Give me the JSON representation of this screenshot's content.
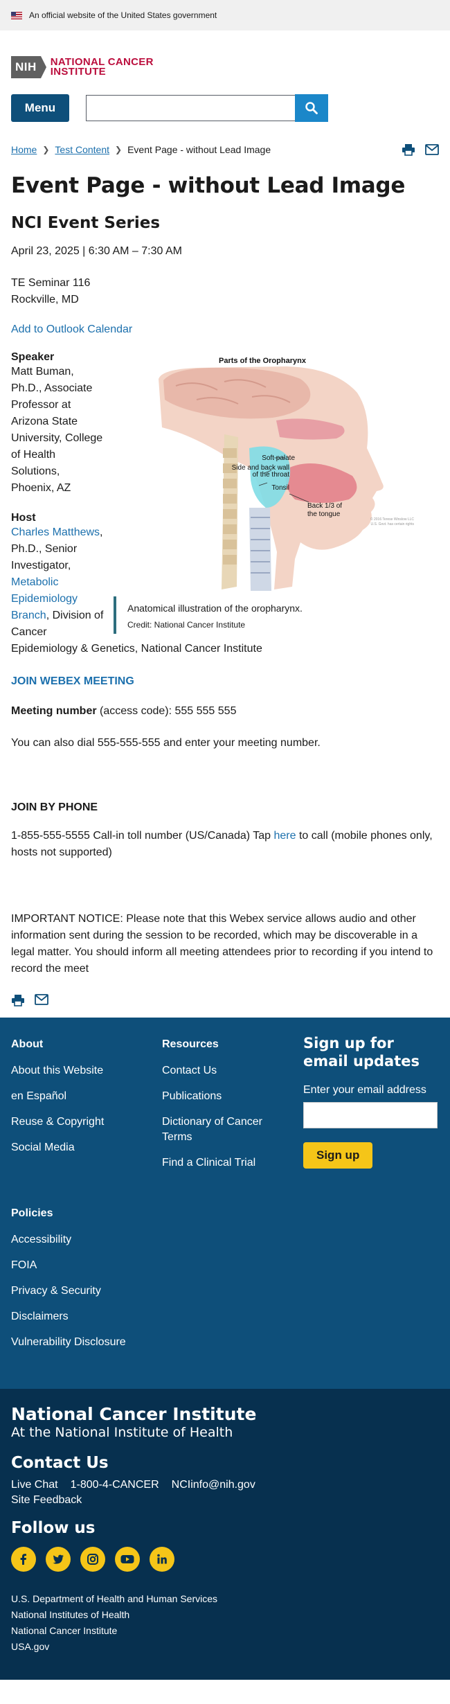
{
  "gov_banner": {
    "text": "An official website of the United States government"
  },
  "logo": {
    "nih": "NIH",
    "line1": "NATIONAL CANCER",
    "line2": "INSTITUTE"
  },
  "header": {
    "menu_label": "Menu",
    "search_placeholder": ""
  },
  "breadcrumb": {
    "items": [
      "Home",
      "Test Content"
    ],
    "current": "Event Page - without Lead Image"
  },
  "page": {
    "title": "Event Page - without Lead Image",
    "series": "NCI Event Series",
    "date": "April 23, 2025 | 6:30 AM – 7:30 AM",
    "venue_line1": "TE Seminar 116",
    "venue_line2": "Rockville, MD",
    "calendar_link": "Add to Outlook Calendar"
  },
  "speaker": {
    "label": "Speaker",
    "text": "Matt Buman, Ph.D., Associate Professor at Arizona State University, College of Health Solutions, Phoenix, AZ"
  },
  "host": {
    "label": "Host",
    "name_link": "Charles Matthews",
    "title": ", Ph.D., Senior Investigator, ",
    "branch_link": "Metabolic Epidemiology Branch",
    "division": ", Division of Cancer Epidemiology & Genetics, National Cancer Institute"
  },
  "figure": {
    "title": "Parts of the Oropharynx",
    "labels": [
      "Soft palate",
      "Side and back wall",
      "of the throat",
      "Tonsil",
      "Back 1/3 of",
      "the tongue"
    ],
    "copyright": "© 2016 Terese Winslow LLC",
    "copyright2": "U.S. Govt. has certain rights",
    "caption": "Anatomical illustration of the oropharynx.",
    "credit": "Credit: National Cancer Institute"
  },
  "webex": {
    "join_link": "JOIN WEBEX MEETING",
    "meeting_label": "Meeting number",
    "meeting_rest": " (access code): 555 555 555",
    "dial_text": "You can also dial 555-555-555 and enter your meeting number.",
    "phone_heading": "JOIN BY PHONE",
    "phone_pre": "1-855-555-5555 Call-in toll number (US/Canada) Tap ",
    "phone_link": "here",
    "phone_post": " to call (mobile phones only, hosts not supported)",
    "notice": "IMPORTANT NOTICE: Please note that this Webex service allows audio and other information sent during the session to be recorded, which may be discoverable in a legal matter. You should inform all meeting attendees prior to recording if you intend to record the meet"
  },
  "footer": {
    "about": {
      "heading": "About",
      "links": [
        "About this Website",
        "en Español",
        "Reuse & Copyright",
        "Social Media"
      ]
    },
    "resources": {
      "heading": "Resources",
      "links": [
        "Contact Us",
        "Publications",
        "Dictionary of Cancer Terms",
        "Find a Clinical Trial"
      ]
    },
    "policies": {
      "heading": "Policies",
      "links": [
        "Accessibility",
        "FOIA",
        "Privacy & Security",
        "Disclaimers",
        "Vulnerability Disclosure"
      ]
    },
    "signup": {
      "title": "Sign up for email updates",
      "label": "Enter your email address",
      "button": "Sign up"
    }
  },
  "bottom": {
    "org_name": "National Cancer Institute",
    "org_sub": "At the National Institute of Health",
    "contact_heading": "Contact Us",
    "contact": [
      "Live Chat",
      "1-800-4-CANCER",
      "NCIinfo@nih.gov"
    ],
    "feedback": "Site Feedback",
    "follow_heading": "Follow us",
    "agencies": [
      "U.S. Department of Health and Human Services",
      "National Institutes of Health",
      "National Cancer Institute",
      "USA.gov"
    ]
  },
  "colors": {
    "primary": "#0e4f7a",
    "link": "#1c70ad",
    "accent_red": "#bb0e3d",
    "yellow": "#f5c518",
    "dark": "#07304f"
  }
}
